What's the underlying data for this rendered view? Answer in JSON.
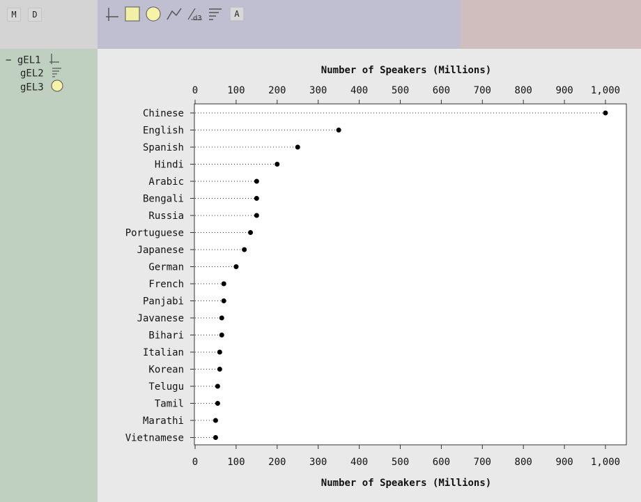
{
  "toolbar": {
    "left_buttons": [
      {
        "id": "m",
        "label": "M"
      },
      {
        "id": "d",
        "label": "D"
      }
    ],
    "tools": [
      {
        "name": "axis-tool-icon"
      },
      {
        "name": "rectangle-tool-icon"
      },
      {
        "name": "circle-tool-icon"
      },
      {
        "name": "line-tool-icon"
      },
      {
        "name": "d3-tool-icon",
        "text": "d3"
      },
      {
        "name": "bar-tool-icon"
      },
      {
        "name": "text-tool-icon",
        "text": "A"
      }
    ]
  },
  "tree": {
    "collapse_glyph": "−",
    "items": [
      {
        "label": "gEL1",
        "icon": "axis-icon"
      },
      {
        "label": "gEL2",
        "icon": "bars-icon"
      },
      {
        "label": "gEL3",
        "icon": "circle-icon"
      }
    ]
  },
  "colors": {
    "rect_fill": "#f2f0a6",
    "circle_fill": "#f6f3a8",
    "dot": "#000000"
  },
  "chart_data": {
    "type": "scatter",
    "variant": "dot-plot",
    "title_top": "Number of Speakers (Millions)",
    "xlabel": "Number of Speakers (Millions)",
    "xlim": [
      0,
      1000
    ],
    "xticks": [
      0,
      100,
      200,
      300,
      400,
      500,
      600,
      700,
      800,
      900,
      1000
    ],
    "xtick_labels": [
      "0",
      "100",
      "200",
      "300",
      "400",
      "500",
      "600",
      "700",
      "800",
      "900",
      "1,000"
    ],
    "grid": false,
    "categories": [
      "Chinese",
      "English",
      "Spanish",
      "Hindi",
      "Arabic",
      "Bengali",
      "Russia",
      "Portuguese",
      "Japanese",
      "German",
      "French",
      "Panjabi",
      "Javanese",
      "Bihari",
      "Italian",
      "Korean",
      "Telugu",
      "Tamil",
      "Marathi",
      "Vietnamese"
    ],
    "values": [
      1000,
      350,
      250,
      200,
      150,
      150,
      150,
      135,
      120,
      100,
      70,
      70,
      65,
      65,
      60,
      60,
      55,
      55,
      50,
      50
    ]
  }
}
